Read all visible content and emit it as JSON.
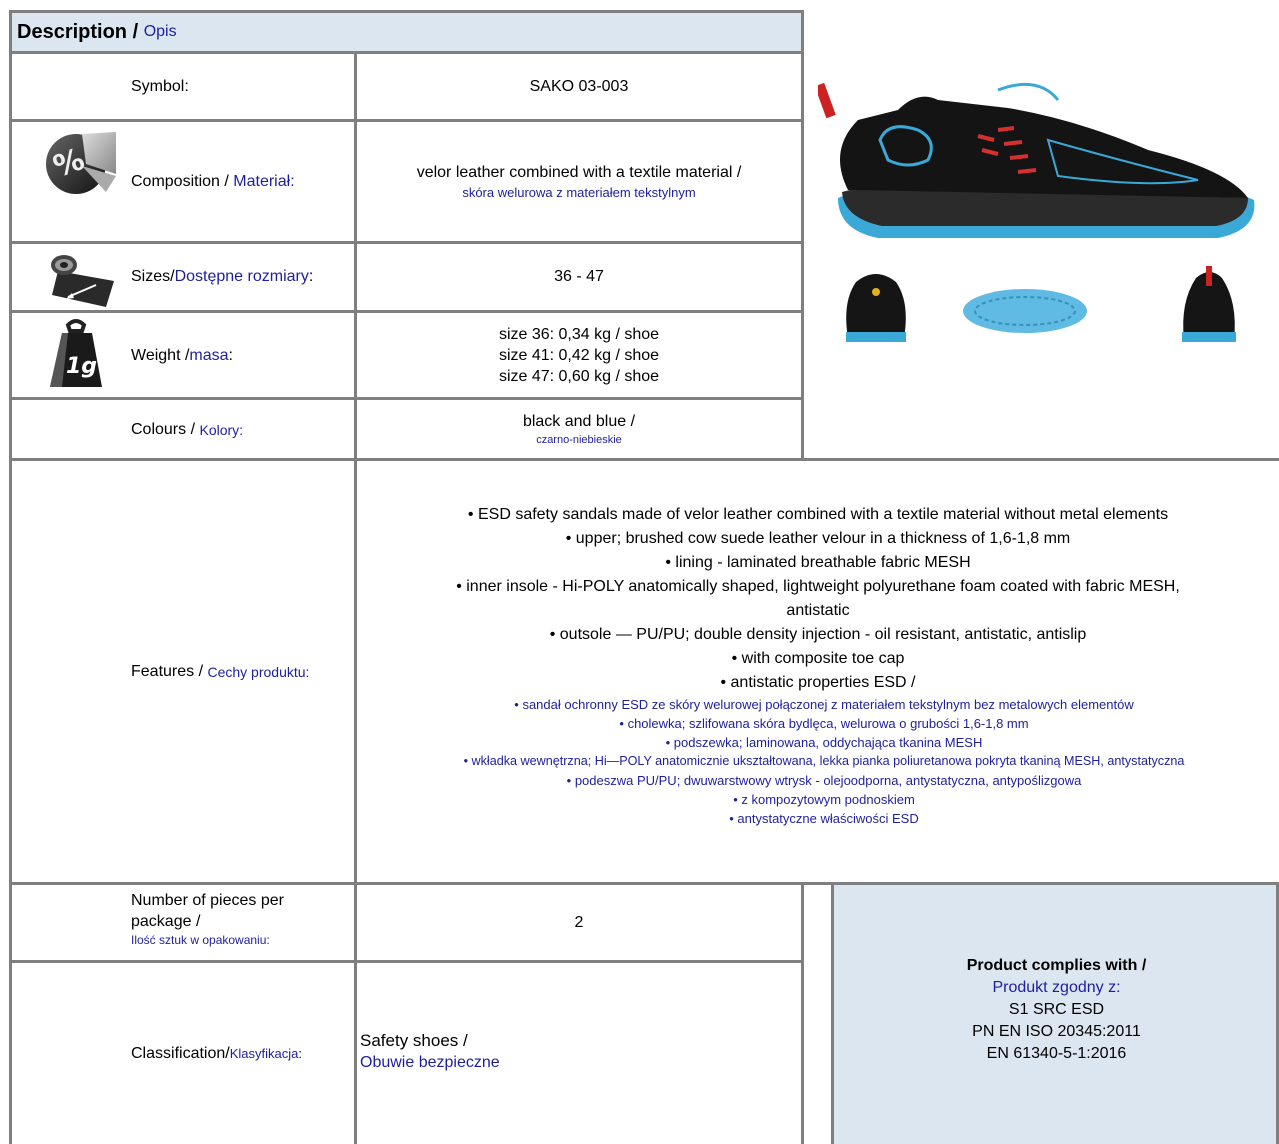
{
  "header": {
    "title_en": "Description / ",
    "title_pl": "Opis"
  },
  "rows": {
    "symbol": {
      "label": "Symbol:",
      "value": "SAKO 03-003"
    },
    "composition": {
      "label_en": "Composition / ",
      "label_pl": "Materiał:",
      "value_en": "velor leather combined with a textile material /",
      "value_pl": "skóra welurowa z materiałem tekstylnym"
    },
    "sizes": {
      "label_en": "Sizes/ ",
      "label_pl": "Dostępne rozmiary",
      "label_colon": ":",
      "value": "36 - 47"
    },
    "weight": {
      "label_en": "Weight / ",
      "label_pl": "masa",
      "label_colon": ":",
      "values": [
        "size 36: 0,34 kg / shoe",
        "size 41: 0,42 kg / shoe",
        "size 47: 0,60 kg / shoe"
      ]
    },
    "colours": {
      "label_en": "Colours / ",
      "label_pl": "Kolory:",
      "value_en": "black and blue /",
      "value_pl": "czarno-niebieskie"
    },
    "features": {
      "label_en": "Features / ",
      "label_pl": "Cechy produktu:",
      "lines_en": [
        "• ESD safety sandals made of velor leather combined with a textile material without metal elements",
        "• upper; brushed cow suede leather velour in a thickness of 1,6-1,8 mm",
        "• lining - laminated breathable fabric MESH",
        "• inner insole - Hi-POLY anatomically shaped, lightweight polyurethane foam coated with fabric MESH,",
        "antistatic",
        "• outsole — PU/PU; double density injection - oil resistant, antistatic, antislip",
        "• with composite toe cap",
        "• antistatic properties ESD /"
      ],
      "lines_pl": [
        "• sandał ochronny ESD ze skóry welurowej połączonej z materiałem tekstylnym bez metalowych elementów",
        "• cholewka; szlifowana skóra bydlęca, welurowa o grubości 1,6-1,8 mm",
        "• podszewka; laminowana, oddychająca tkanina MESH",
        "• wkładka wewnętrzna; Hi—POLY anatomicznie ukształtowana, lekka pianka poliuretanowa pokryta tkaniną MESH, antystatyczna",
        "• podeszwa PU/PU; dwuwarstwowy wtrysk - olejoodporna, antystatyczna, antypoślizgowa",
        "• z kompozytowym podnoskiem",
        "• antystatyczne właściwości ESD"
      ]
    },
    "pieces": {
      "label_en_1": "Number of pieces per",
      "label_en_2": "package /",
      "label_pl": "Ilość sztuk w opakowaniu:",
      "value": "2"
    },
    "classification": {
      "label_en": "Classification/ ",
      "label_pl": "Klasyfikacja",
      "label_colon": ":",
      "value_en": "Safety shoes /",
      "value_pl": "Obuwie bezpieczne"
    }
  },
  "compliance": {
    "title_en": "Product complies with /",
    "title_pl": "Produkt zgodny z:",
    "items": [
      "S1 SRC ESD",
      "PN EN ISO 20345:2011",
      "EN 61340-5-1:2016"
    ]
  },
  "icons": {
    "composition": "percent-pie-icon",
    "sizes": "measuring-tape-roll-icon",
    "weight": "weight-1g-icon",
    "weight_text": "1g",
    "percent_text": "%"
  },
  "colors": {
    "header_bg": "#dce6f1",
    "polish_text": "#1f1f9a",
    "border": "#7f7f7f"
  }
}
